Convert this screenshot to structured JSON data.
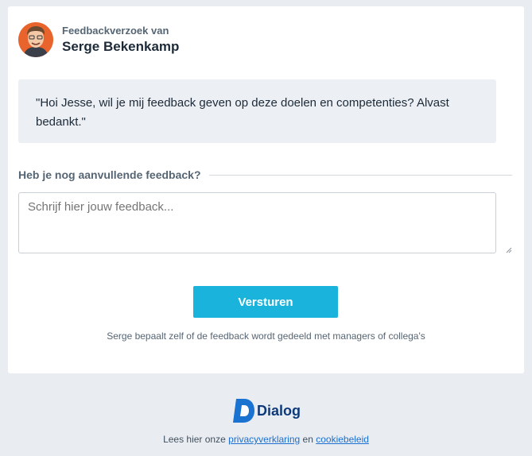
{
  "header": {
    "subtitle": "Feedbackverzoek van",
    "name": "Serge Bekenkamp"
  },
  "message": {
    "text": "\"Hoi Jesse, wil je mij feedback geven op deze doelen en competenties? Alvast bedankt.\""
  },
  "feedback": {
    "label": "Heb je nog aanvullende feedback?",
    "placeholder": "Schrijf hier jouw feedback...",
    "value": ""
  },
  "actions": {
    "send_label": "Versturen"
  },
  "notice": "Serge bepaalt zelf of de feedback wordt gedeeld met managers of collega's",
  "footer": {
    "brand": "Dialog",
    "prefix": "Lees hier onze",
    "privacy_link": "privacyverklaring",
    "conjunction": "en",
    "cookie_link": "cookiebeleid"
  },
  "colors": {
    "accent": "#19b3db",
    "brand": "#0e3a7a",
    "avatar_bg": "#e8642c"
  },
  "icons": {
    "avatar": "user-avatar",
    "logo": "dialog-logo-icon",
    "resize": "resize-grip-icon"
  }
}
